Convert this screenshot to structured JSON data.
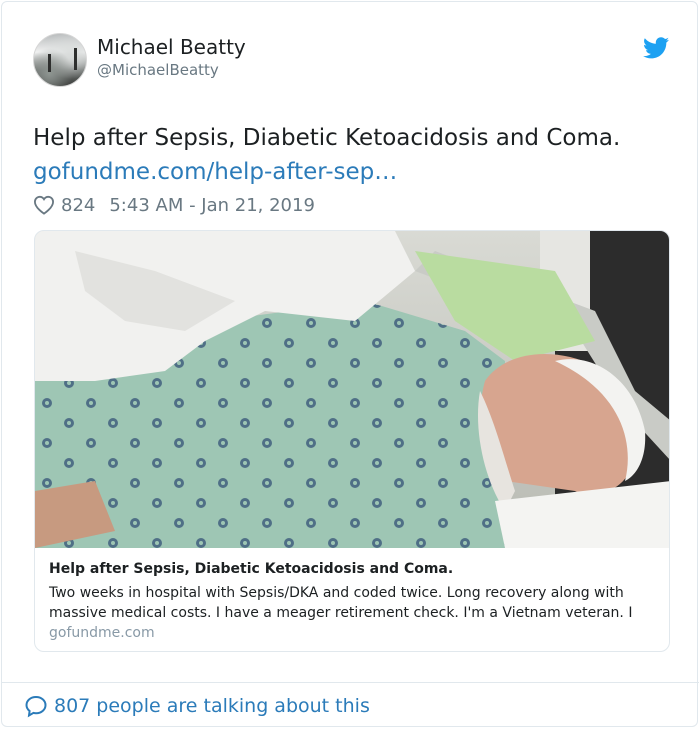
{
  "author": {
    "name": "Michael Beatty",
    "handle": "@MichaelBeatty",
    "avatar_icon": "avatar-photo"
  },
  "tweet": {
    "text": "Help after Sepsis, Diabetic Ketoacidosis and Coma.",
    "link": "gofundme.com/help-after-sep…",
    "like_count": "824",
    "timestamp": "5:43 AM - Jan 21, 2019"
  },
  "card": {
    "title": "Help after Sepsis, Diabetic Ketoacidosis and Coma.",
    "description": "Two weeks in hospital with Sepsis/DKA and coded twice. Long recovery along with massive medical costs.  I have a meager retirement check. I'm a Vietnam veteran.  I",
    "domain": "gofundme.com"
  },
  "footer": {
    "talking": "807 people are talking about this"
  },
  "colors": {
    "link": "#2b7bb9",
    "twitter_blue": "#1da1f2",
    "muted": "#697882",
    "border": "#e1e8ed"
  }
}
